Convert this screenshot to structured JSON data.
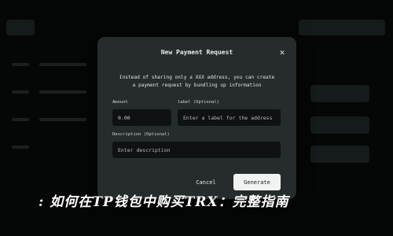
{
  "modal": {
    "title": "New Payment Request",
    "close_icon": "close-icon",
    "description_line1": "Instead of sharing only a XXX address, you can create",
    "description_line2": "a payment request by bundling up information",
    "amount": {
      "label": "Amount",
      "value": "0.00"
    },
    "label_field": {
      "label": "label (Optional)",
      "placeholder": "Enter a label for the address"
    },
    "description_field": {
      "label": "Description (Optional)",
      "placeholder": "Enter description"
    },
    "cancel_label": "Cancel",
    "generate_label": "Generate"
  },
  "caption": ": 如何在TP钱包中购买TRX：完整指南",
  "colors": {
    "background": "#050606",
    "modal": "#262b2c",
    "input": "#0f1212",
    "primary_button": "#f1f2f2"
  }
}
